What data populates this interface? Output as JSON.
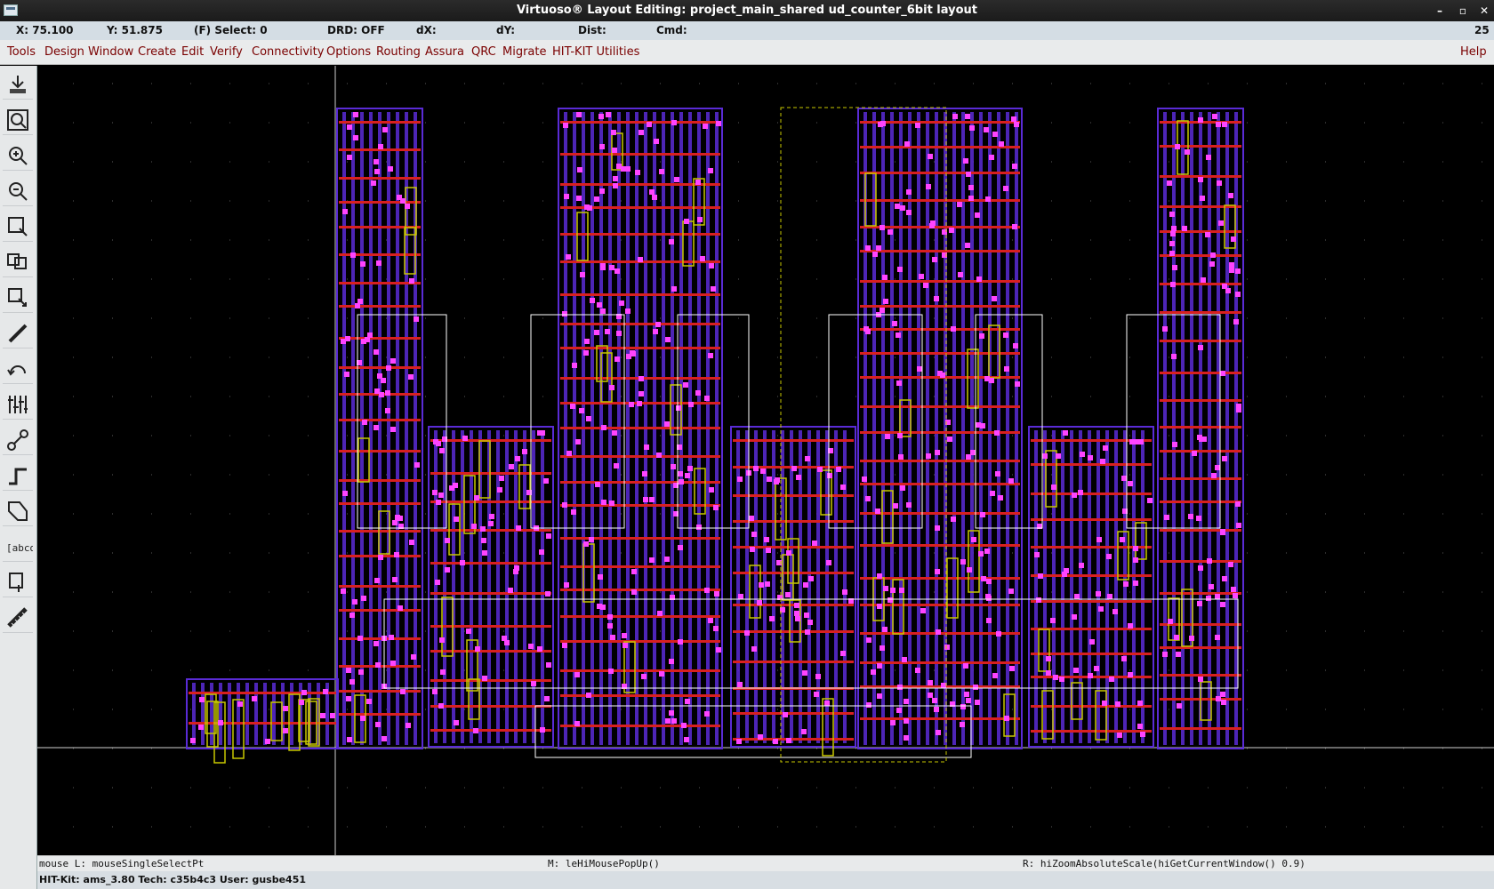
{
  "window": {
    "title": "Virtuoso® Layout Editing: project_main_shared ud_counter_6bit layout"
  },
  "status": {
    "x": "X:  75.100",
    "y": "Y:  51.875",
    "select": "(F) Select: 0",
    "drd": "DRD: OFF",
    "dx": "dX:",
    "dy": "dY:",
    "dist": "Dist:",
    "cmd": "Cmd:",
    "count": "25"
  },
  "menus": [
    "Tools",
    "Design",
    "Window",
    "Create",
    "Edit",
    "Verify",
    "Connectivity",
    "Options",
    "Routing",
    "Assura",
    "QRC",
    "Migrate",
    "HIT-KIT Utilities"
  ],
  "help": "Help",
  "toolbar_icons": [
    "save-icon",
    "fit-view-icon",
    "zoom-in-icon",
    "zoom-out-icon",
    "stretch-icon",
    "copy-icon",
    "move-icon",
    "path-icon",
    "undo-icon",
    "property-icon",
    "ruler-icon",
    "wire-icon",
    "polygon-icon",
    "label-icon",
    "instance-icon",
    "measure-icon"
  ],
  "mouse_bar": {
    "left": "mouse L: mouseSingleSelectPt",
    "middle": "M: leHiMousePopUp()",
    "right": "R: hiZoomAbsoluteScale(hiGetCurrentWindow() 0.9)"
  },
  "info_bar": "HIT-Kit: ams_3.80   Tech: c35b4c3   User: gusbe451",
  "colors": {
    "canvas": "#000000",
    "metal1": "#5a2bd6",
    "metal2": "#d82020",
    "poly": "#c8c800",
    "via": "#ff44ff",
    "route": "#ffffff",
    "menu_text": "#7a0000"
  }
}
